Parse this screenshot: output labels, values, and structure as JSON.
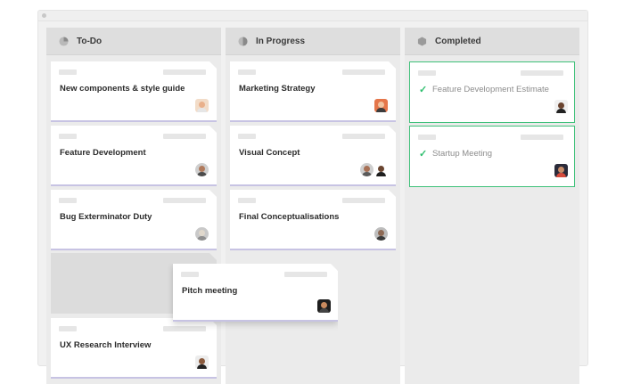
{
  "board": {
    "columns": [
      {
        "title": "To-Do",
        "icon": "pie-quarter-icon",
        "cards": [
          {
            "title": "New components & style guide"
          },
          {
            "title": "Feature Development"
          },
          {
            "title": "Bug  Exterminator Duty"
          },
          {
            "title": "UX Research Interview"
          }
        ]
      },
      {
        "title": "In Progress",
        "icon": "pie-half-icon",
        "cards": [
          {
            "title": "Marketing Strategy"
          },
          {
            "title": "Visual Concept"
          },
          {
            "title": "Final Conceptualisations"
          }
        ]
      },
      {
        "title": "Completed",
        "icon": "hexagon-icon",
        "cards": [
          {
            "title": "Feature Development Estimate"
          },
          {
            "title": "Startup Meeting"
          }
        ]
      }
    ],
    "dragging_card": {
      "title": "Pitch meeting"
    }
  },
  "colors": {
    "accent_border": "#c7c3e3",
    "completed_green": "#3fc17a",
    "column_bg": "#ebebeb",
    "header_bg": "#dedede"
  }
}
